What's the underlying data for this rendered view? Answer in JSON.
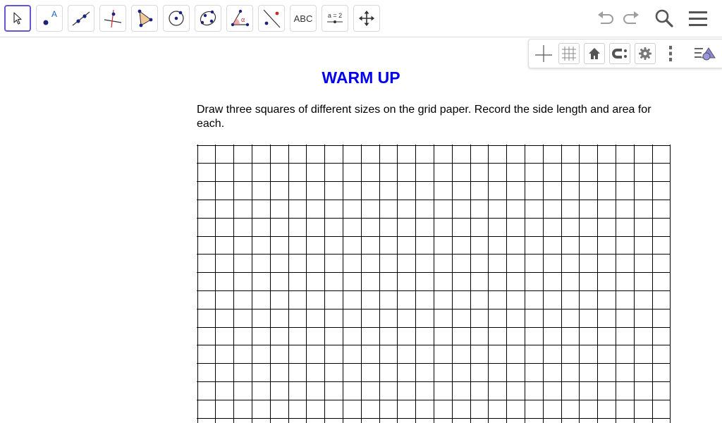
{
  "toolbar": {
    "tools": [
      {
        "name": "move-tool",
        "icon": "arrow-cursor-icon",
        "active": true
      },
      {
        "name": "point-tool",
        "icon": "point-icon",
        "label": "A"
      },
      {
        "name": "line-tool",
        "icon": "line-through-points-icon"
      },
      {
        "name": "perpendicular-line-tool",
        "icon": "perpendicular-line-icon"
      },
      {
        "name": "polygon-tool",
        "icon": "polygon-icon"
      },
      {
        "name": "circle-center-point-tool",
        "icon": "circle-center-icon"
      },
      {
        "name": "conic-five-points-tool",
        "icon": "ellipse-points-icon"
      },
      {
        "name": "angle-tool",
        "icon": "angle-icon",
        "label": "α"
      },
      {
        "name": "reflect-tool",
        "icon": "reflect-about-line-icon"
      },
      {
        "name": "text-tool",
        "label": "ABC"
      },
      {
        "name": "slider-tool",
        "label": "a = 2"
      },
      {
        "name": "move-graphics-view-tool",
        "icon": "move-arrows-icon"
      }
    ],
    "right": [
      "undo-icon",
      "redo-icon",
      "search-icon",
      "menu-icon"
    ]
  },
  "graphics_bar": {
    "buttons": [
      "axes-icon",
      "grid-icon",
      "home-icon",
      "point-capturing-icon",
      "settings-icon",
      "more-vertical-icon"
    ],
    "style_bar_toggle": "style-bar-toggle-icon"
  },
  "content": {
    "title": "WARM UP",
    "instructions": "Draw three squares of different sizes on the grid paper. Record the side length and area for each."
  },
  "colors": {
    "accent": "#6557d2",
    "title": "#0000ee",
    "point": "#1a237e",
    "text": "#000000"
  }
}
